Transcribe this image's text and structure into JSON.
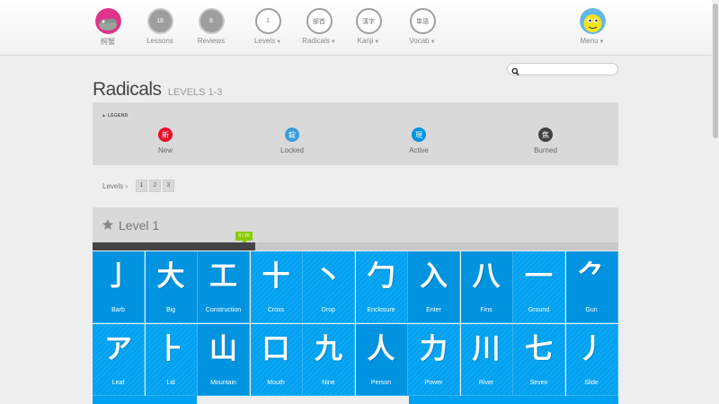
{
  "header": {
    "user_label": "鰐蟹",
    "lessons": {
      "count": "18",
      "label": "Lessons"
    },
    "reviews": {
      "count": "8",
      "label": "Reviews"
    },
    "levels": {
      "badge": "1",
      "label": "Levels"
    },
    "radicals": {
      "badge": "部首",
      "label": "Radicals"
    },
    "kanji": {
      "badge": "漢字",
      "label": "Kanji"
    },
    "vocab": {
      "badge": "単語",
      "label": "Vocab"
    },
    "menu": {
      "label": "Menu"
    }
  },
  "search": {
    "placeholder": "",
    "value": ""
  },
  "page": {
    "title": "Radicals",
    "subtitle": "LEVELS 1-3"
  },
  "legend": {
    "title": "LEGEND",
    "items": [
      {
        "glyph": "新",
        "label": "New",
        "color": "#e8112d"
      },
      {
        "glyph": "錠",
        "label": "Locked",
        "color": "#3d9bdc"
      },
      {
        "glyph": "現",
        "label": "Active",
        "color": "#0093e0"
      },
      {
        "glyph": "焦",
        "label": "Burned",
        "color": "#434343"
      }
    ]
  },
  "levels_nav": {
    "label": "Levels",
    "pages": [
      "1",
      "2",
      "3"
    ]
  },
  "level": {
    "title": "Level 1",
    "progress_text": "8 / 26",
    "progress_fraction": 0.31,
    "radicals": [
      {
        "char": "亅",
        "name": "Barb"
      },
      {
        "char": "大",
        "name": "Big"
      },
      {
        "char": "工",
        "name": "Construction"
      },
      {
        "char": "十",
        "name": "Cross"
      },
      {
        "char": "丶",
        "name": "Drop"
      },
      {
        "char": "勹",
        "name": "Enclosure"
      },
      {
        "char": "入",
        "name": "Enter"
      },
      {
        "char": "八",
        "name": "Fins"
      },
      {
        "char": "一",
        "name": "Ground"
      },
      {
        "char": "⺈",
        "name": "Gun"
      },
      {
        "char": "ア",
        "name": "Leaf"
      },
      {
        "char": "⺊",
        "name": "Lid"
      },
      {
        "char": "山",
        "name": "Mountain"
      },
      {
        "char": "口",
        "name": "Mouth"
      },
      {
        "char": "九",
        "name": "Nine"
      },
      {
        "char": "人",
        "name": "Person"
      },
      {
        "char": "力",
        "name": "Power"
      },
      {
        "char": "川",
        "name": "River"
      },
      {
        "char": "七",
        "name": "Seven"
      },
      {
        "char": "丿",
        "name": "Slide"
      }
    ]
  }
}
